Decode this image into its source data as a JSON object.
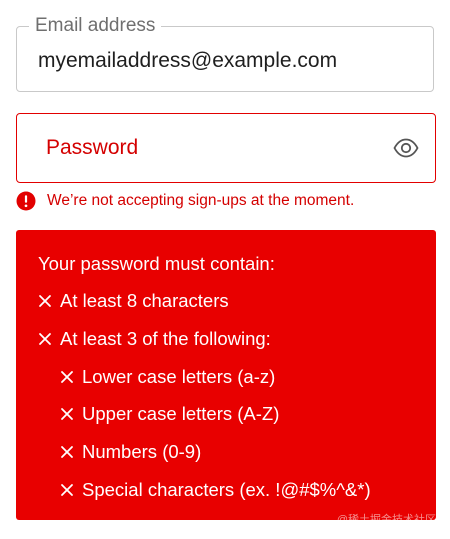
{
  "email": {
    "label": "Email address",
    "value": "myemailaddress@example.com"
  },
  "password": {
    "placeholder": "Password",
    "toggle_icon": "eye-icon"
  },
  "error": {
    "icon": "error-icon",
    "message": "We’re not accepting sign-ups at the moment."
  },
  "requirements": {
    "title": "Your password must contain:",
    "items": [
      {
        "label": "At least 8 characters",
        "met": false
      },
      {
        "label": "At least 3 of the following:",
        "met": false
      },
      {
        "label": "Lower case letters (a-z)",
        "met": false
      },
      {
        "label": "Upper case letters (A-Z)",
        "met": false
      },
      {
        "label": "Numbers (0-9)",
        "met": false
      },
      {
        "label": "Special characters (ex. !@#$%^&*)",
        "met": false
      }
    ]
  },
  "watermark": "@稀土掘金技术社区",
  "colors": {
    "error": "#e20000",
    "panel": "#e80000"
  }
}
